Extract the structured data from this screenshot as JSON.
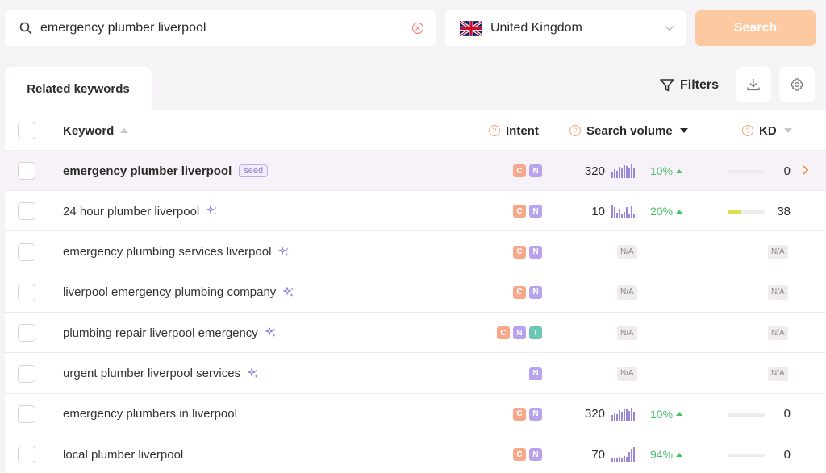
{
  "search": {
    "query": "emergency plumber liverpool"
  },
  "country": {
    "name": "United Kingdom"
  },
  "search_button": {
    "label": "Search"
  },
  "tabs": [
    {
      "label": "Related keywords"
    }
  ],
  "toolbar": {
    "filters_label": "Filters"
  },
  "table": {
    "headers": {
      "keyword": "Keyword",
      "intent": "Intent",
      "volume": "Search volume",
      "kd": "KD"
    },
    "rows": [
      {
        "keyword": "emergency plumber liverpool",
        "seed": true,
        "seed_label": "seed",
        "intent": [
          "C",
          "N"
        ],
        "volume": "320",
        "trend": "10%",
        "bars": [
          8,
          11,
          9,
          14,
          12,
          16,
          15,
          13,
          17,
          12
        ],
        "kd": "0",
        "kd_fill": 0
      },
      {
        "keyword": "24 hour plumber liverpool",
        "ai": true,
        "intent": [
          "C",
          "N"
        ],
        "volume": "10",
        "trend": "20%",
        "bars": [
          16,
          14,
          7,
          12,
          6,
          8,
          14,
          5,
          15,
          6
        ],
        "kd": "38",
        "kd_fill": 0.38
      },
      {
        "keyword": "emergency plumbing services liverpool",
        "ai": true,
        "intent": [
          "C",
          "N"
        ],
        "volume": "N/A",
        "kd": "N/A"
      },
      {
        "keyword": "liverpool emergency plumbing company",
        "ai": true,
        "intent": [
          "C",
          "N"
        ],
        "volume": "N/A",
        "kd": "N/A"
      },
      {
        "keyword": "plumbing repair liverpool emergency",
        "ai": true,
        "intent": [
          "C",
          "N",
          "T"
        ],
        "volume": "N/A",
        "kd": "N/A"
      },
      {
        "keyword": "urgent plumber liverpool services",
        "ai": true,
        "intent": [
          "N"
        ],
        "volume": "N/A",
        "kd": "N/A"
      },
      {
        "keyword": "emergency plumbers in liverpool",
        "intent": [
          "C",
          "N"
        ],
        "volume": "320",
        "trend": "10%",
        "bars": [
          8,
          11,
          9,
          14,
          12,
          16,
          15,
          13,
          17,
          12
        ],
        "kd": "0",
        "kd_fill": 0
      },
      {
        "keyword": "local plumber liverpool",
        "intent": [
          "C",
          "N"
        ],
        "volume": "70",
        "trend": "94%",
        "bars": [
          4,
          5,
          4,
          6,
          5,
          7,
          6,
          12,
          16,
          18
        ],
        "kd": "0",
        "kd_fill": 0
      }
    ]
  },
  "colors": {
    "accent": "#fcc9a1",
    "trend_up": "#4cbf6b",
    "bars": "#9a86dc",
    "intent_c": "#f6a98a",
    "intent_n": "#b9a3ec",
    "intent_t": "#6cc7b2"
  }
}
